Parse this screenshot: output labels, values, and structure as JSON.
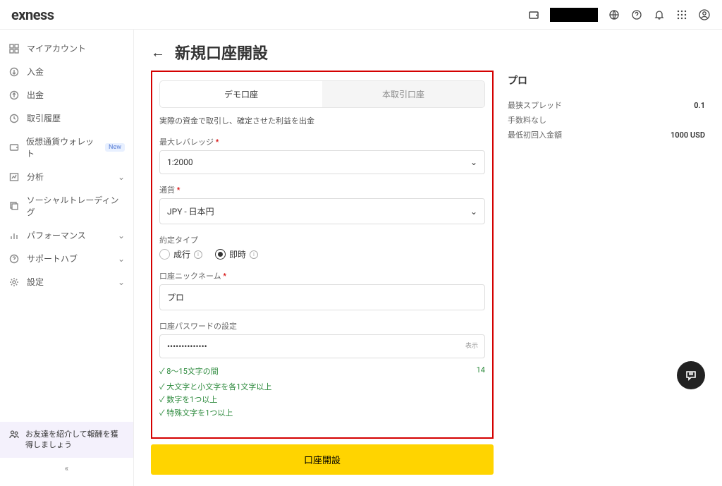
{
  "logo": "exness",
  "sidebar": {
    "items": [
      {
        "label": "マイアカウント"
      },
      {
        "label": "入金"
      },
      {
        "label": "出金"
      },
      {
        "label": "取引履歴"
      },
      {
        "label": "仮想通貨ウォレット",
        "badge": "New"
      },
      {
        "label": "分析",
        "expand": true
      },
      {
        "label": "ソーシャルトレーディング"
      },
      {
        "label": "パフォーマンス",
        "expand": true
      },
      {
        "label": "サポートハブ",
        "expand": true
      },
      {
        "label": "設定",
        "expand": true
      }
    ],
    "promo": "お友達を紹介して報酬を獲得しましょう",
    "collapse": "«"
  },
  "page": {
    "title": "新規口座開設",
    "tabs": {
      "demo": "デモ口座",
      "real": "本取引口座"
    },
    "desc": "実際の資金で取引し、確定させた利益を出金",
    "leverage": {
      "label": "最大レバレッジ",
      "value": "1:2000"
    },
    "currency": {
      "label": "通貨",
      "value": "JPY - 日本円"
    },
    "exec": {
      "label": "約定タイプ",
      "market": "成行",
      "instant": "即時"
    },
    "nickname": {
      "label": "口座ニックネーム",
      "value": "プロ"
    },
    "password": {
      "label": "口座パスワードの設定",
      "value": "••••••••••••••",
      "toggle": "表示",
      "count": "14"
    },
    "rules": [
      "8～15文字の間",
      "大文字と小文字を各1文字以上",
      "数字を1つ以上",
      "特殊文字を1つ以上"
    ],
    "submit": "口座開設"
  },
  "plan": {
    "title": "プロ",
    "rows": [
      {
        "k": "最狭スプレッド",
        "v": "0.1"
      },
      {
        "k": "手数料なし",
        "v": ""
      },
      {
        "k": "最低初回入金額",
        "v": "1000 USD"
      }
    ]
  }
}
